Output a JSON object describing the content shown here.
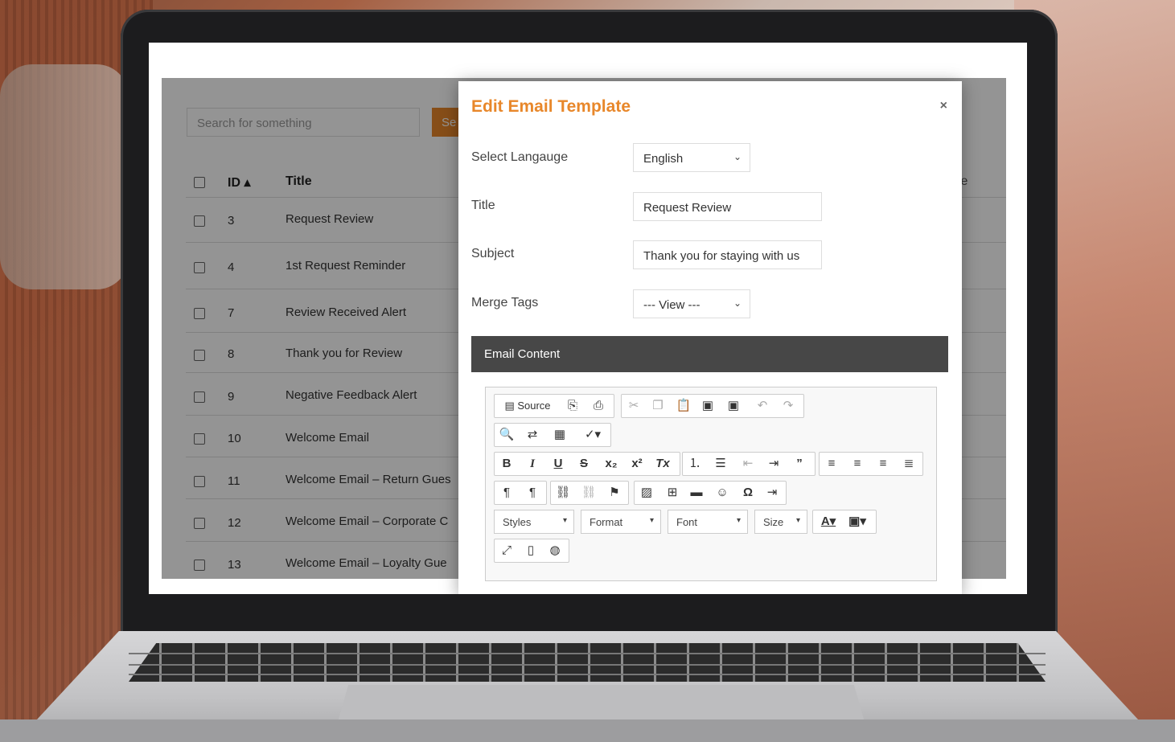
{
  "background": {
    "accent": "#e8872a"
  },
  "list": {
    "search_placeholder": "Search for something",
    "search_button": "Se",
    "headers": {
      "id": "ID ▴",
      "title": "Title",
      "partial": "je"
    },
    "rows": [
      {
        "id": "3",
        "title": "Request Review"
      },
      {
        "id": "4",
        "title": "1st Request Reminder"
      },
      {
        "id": "7",
        "title": "Review Received Alert"
      },
      {
        "id": "8",
        "title": "Thank you for Review"
      },
      {
        "id": "9",
        "title": "Negative Feedback Alert"
      },
      {
        "id": "10",
        "title": "Welcome Email"
      },
      {
        "id": "11",
        "title": "Welcome Email – Return Gues"
      },
      {
        "id": "12",
        "title": "Welcome Email – Corporate C"
      },
      {
        "id": "13",
        "title": "Welcome Email – Loyalty Gue"
      }
    ]
  },
  "modal": {
    "title": "Edit Email Template",
    "close": "×",
    "language_label": "Select Langauge",
    "language_value": "English",
    "title_label": "Title",
    "title_value": "Request Review",
    "subject_label": "Subject",
    "subject_value": "Thank you for staying with us",
    "merge_label": "Merge Tags",
    "merge_value": "--- View ---",
    "content_header": "Email Content",
    "toolbar": {
      "source": "Source",
      "styles": "Styles",
      "format": "Format",
      "font": "Font",
      "size": "Size"
    }
  }
}
